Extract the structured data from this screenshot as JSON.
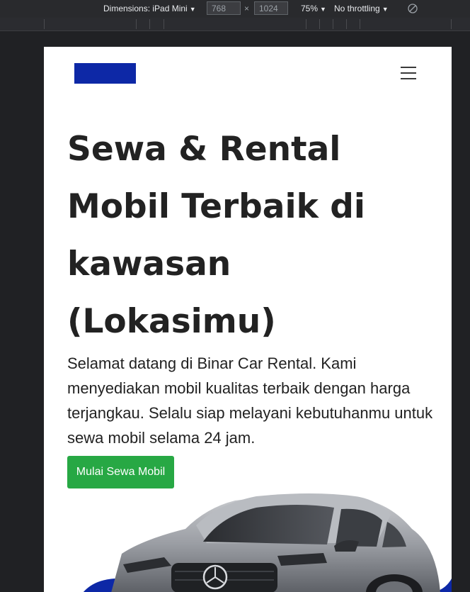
{
  "devtools": {
    "dimensions_label": "Dimensions: iPad Mini",
    "width_value": "768",
    "times": "×",
    "height_value": "1024",
    "zoom_label": "75%",
    "throttling_label": "No throttling",
    "rotate_icon": "rotate-icon"
  },
  "page": {
    "logo_icon": "logo-block",
    "logo_color": "#0d28a6",
    "menu_icon": "hamburger-icon",
    "hero": {
      "title": "Sewa & Rental Mobil Terbaik di kawasan (Lokasimu)",
      "description": "Selamat datang di Binar Car Rental. Kami menyediakan mobil kualitas terbaik dengan harga terjangkau. Selalu siap melayani kebutuhanmu untuk sewa mobil selama 24 jam.",
      "cta_label": "Mulai Sewa Mobil",
      "cta_color": "#27a844"
    },
    "hero_image": "car-image"
  }
}
